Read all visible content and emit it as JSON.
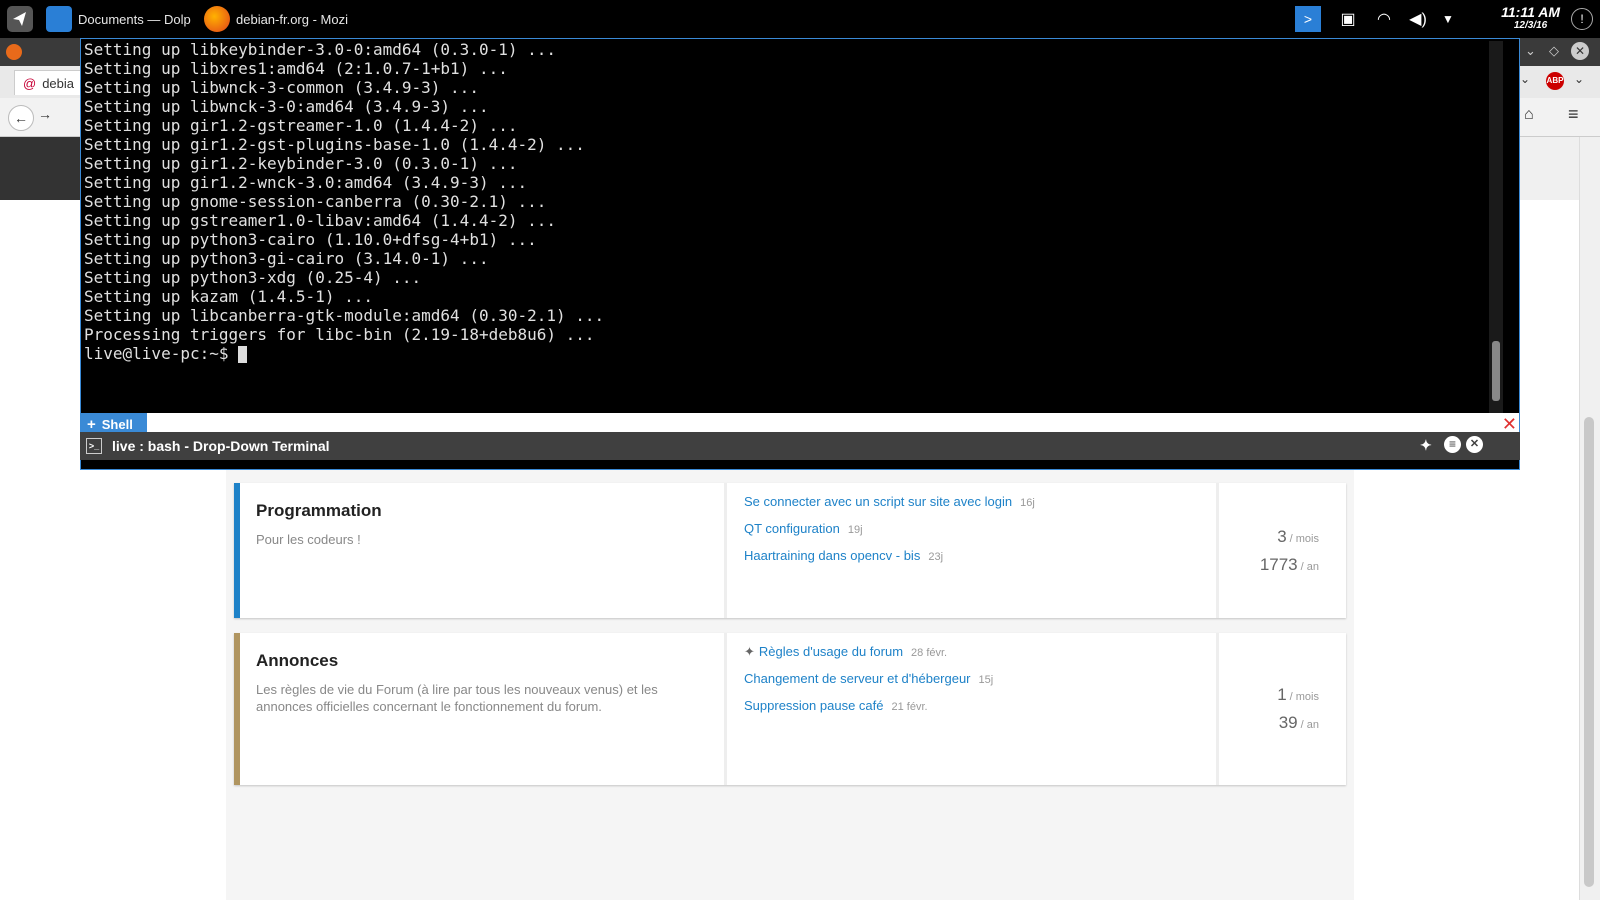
{
  "taskbar": {
    "tasks": [
      {
        "label": "Documents — Dolp"
      },
      {
        "label": "debian-fr.org - Mozi"
      }
    ],
    "clock": {
      "time": "11:11 AM",
      "date": "12/3/16"
    }
  },
  "firefox": {
    "tab_label": "debia"
  },
  "terminal": {
    "lines": [
      "Setting up libkeybinder-3.0-0:amd64 (0.3.0-1) ...",
      "Setting up libxres1:amd64 (2:1.0.7-1+b1) ...",
      "Setting up libwnck-3-common (3.4.9-3) ...",
      "Setting up libwnck-3-0:amd64 (3.4.9-3) ...",
      "Setting up gir1.2-gstreamer-1.0 (1.4.4-2) ...",
      "Setting up gir1.2-gst-plugins-base-1.0 (1.4.4-2) ...",
      "Setting up gir1.2-keybinder-3.0 (0.3.0-1) ...",
      "Setting up gir1.2-wnck-3.0:amd64 (3.4.9-3) ...",
      "Setting up gnome-session-canberra (0.30-2.1) ...",
      "Setting up gstreamer1.0-libav:amd64 (1.4.4-2) ...",
      "Setting up python3-cairo (1.10.0+dfsg-4+b1) ...",
      "Setting up python3-gi-cairo (3.14.0-1) ...",
      "Setting up python3-xdg (0.25-4) ...",
      "Setting up kazam (1.4.5-1) ...",
      "Setting up libcanberra-gtk-module:amd64 (0.30-2.1) ...",
      "Processing triggers for libc-bin (2.19-18+deb8u6) ..."
    ],
    "prompt": "live@live-pc:~$ ",
    "tab_label": "Shell",
    "window_title": "live : bash - Drop-Down Terminal"
  },
  "forum": {
    "categories": [
      {
        "title": "Programmation",
        "description": "Pour les codeurs !",
        "color": "#1e82c8",
        "topics": [
          {
            "title": "Se connecter avec un script sur site avec login",
            "age": "16j"
          },
          {
            "title": "QT configuration",
            "age": "19j"
          },
          {
            "title": "Haartraining dans opencv - bis",
            "age": "23j"
          }
        ],
        "stats": {
          "month": "3",
          "month_label": "/ mois",
          "year": "1773",
          "year_label": "/ an"
        }
      },
      {
        "title": "Annonces",
        "description": "Les règles de vie du Forum (à lire par tous les nouveaux venus) et les annonces officielles concernant le fonctionnement du forum.",
        "color": "#b09560",
        "topics": [
          {
            "title": "Règles d'usage du forum",
            "age": "28 févr.",
            "pinned": true
          },
          {
            "title": "Changement de serveur et d'hébergeur",
            "age": "15j"
          },
          {
            "title": "Suppression pause café",
            "age": "21 févr."
          }
        ],
        "stats": {
          "month": "1",
          "month_label": "/ mois",
          "year": "39",
          "year_label": "/ an"
        }
      }
    ]
  },
  "colors": {
    "accent": "#3a8ad6",
    "link": "#1e82c8"
  }
}
